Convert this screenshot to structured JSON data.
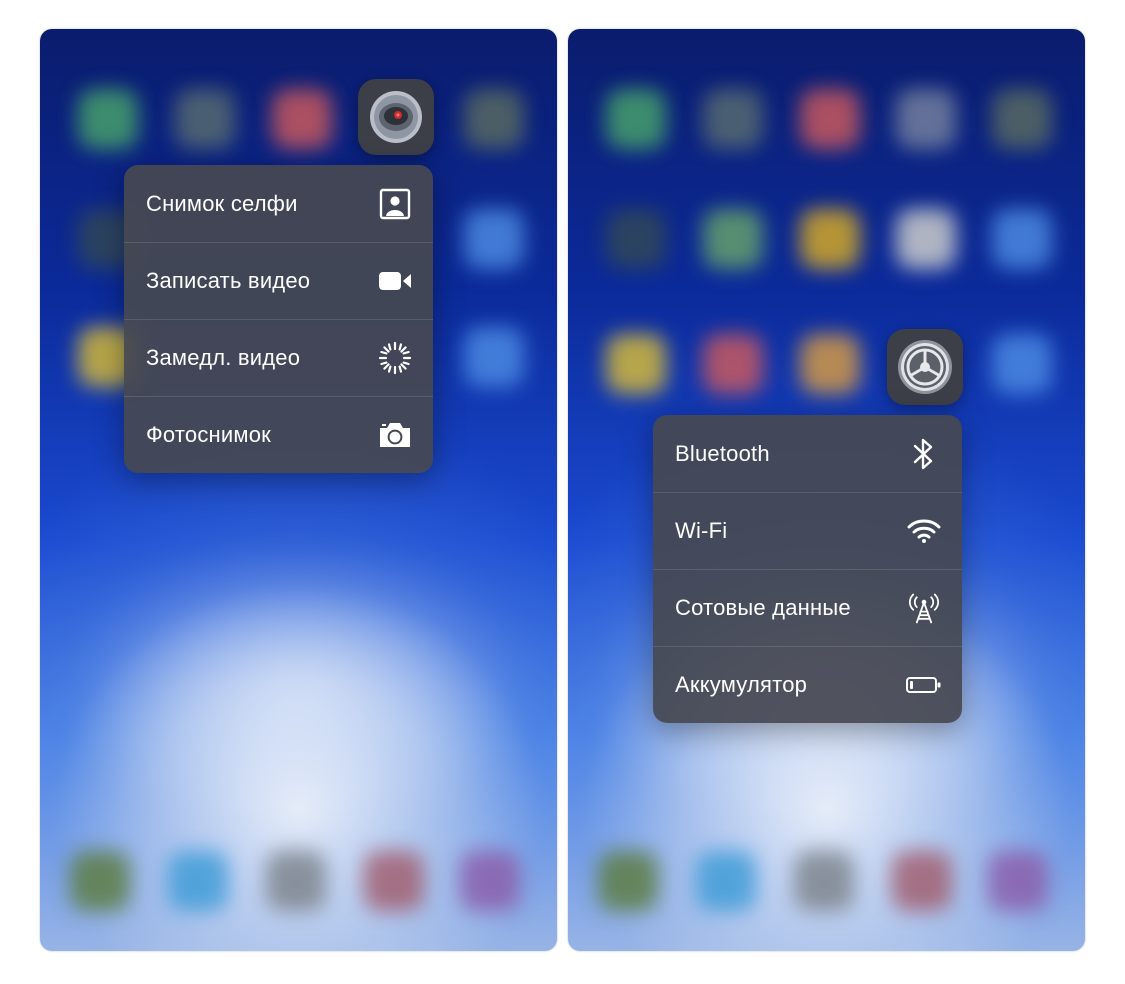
{
  "left_panel": {
    "app": "camera-app-icon",
    "menu": [
      {
        "label": "Снимок селфи",
        "icon": "selfie-portrait-icon"
      },
      {
        "label": "Записать видео",
        "icon": "video-camera-icon"
      },
      {
        "label": "Замедл. видео",
        "icon": "slow-motion-icon"
      },
      {
        "label": "Фотоснимок",
        "icon": "photo-camera-icon"
      }
    ]
  },
  "right_panel": {
    "app": "settings-app-icon",
    "menu": [
      {
        "label": "Bluetooth",
        "icon": "bluetooth-icon"
      },
      {
        "label": "Wi-Fi",
        "icon": "wifi-icon"
      },
      {
        "label": "Сотовые данные",
        "icon": "cellular-antenna-icon"
      },
      {
        "label": "Аккумулятор",
        "icon": "battery-icon"
      }
    ]
  },
  "colors": {
    "menu_background": "#464852",
    "menu_text": "#ffffff",
    "wallpaper_top": "#0a1a66",
    "wallpaper_bottom": "#a6bde6"
  }
}
